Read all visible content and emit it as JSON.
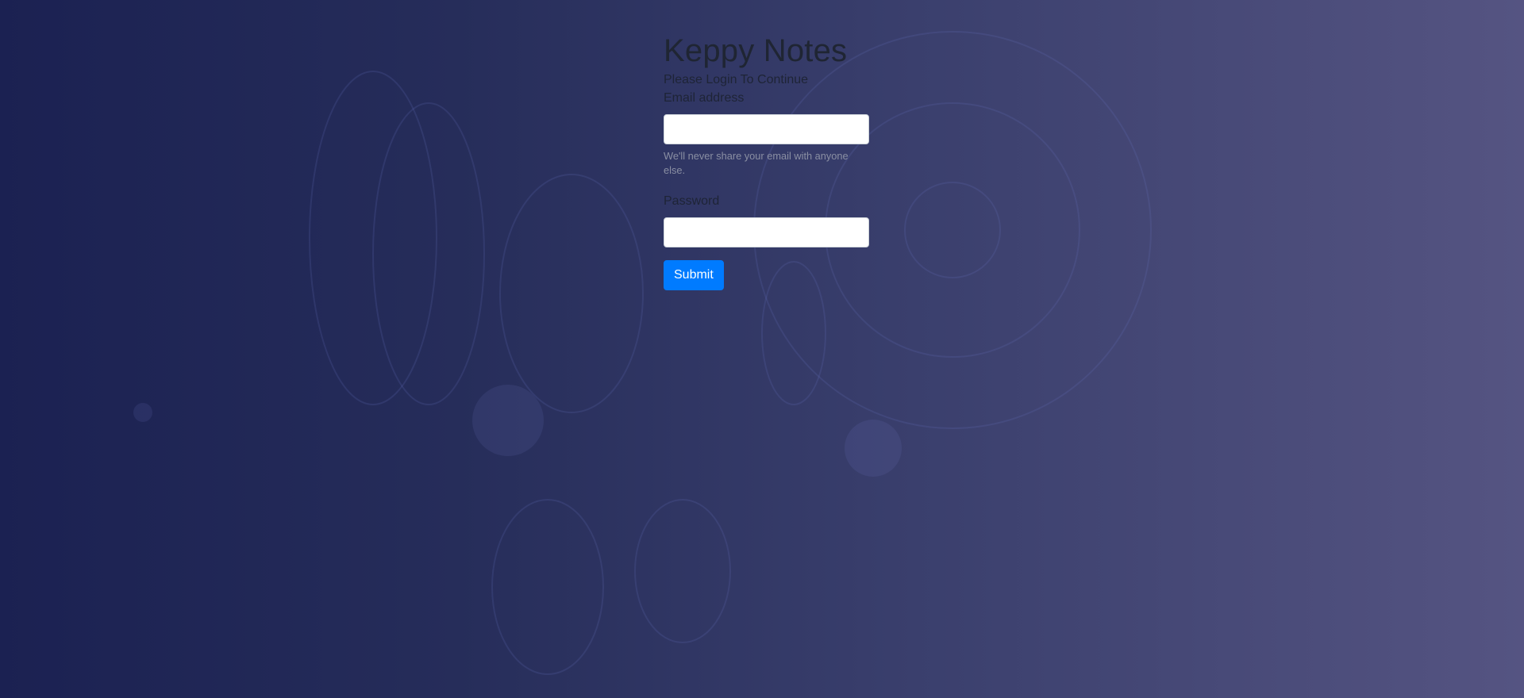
{
  "page": {
    "title": "Keppy Notes",
    "subtitle": "Please Login To Continue"
  },
  "form": {
    "email_label": "Email address",
    "email_value": "",
    "email_help": "We'll never share your email with anyone else.",
    "password_label": "Password",
    "password_value": "",
    "submit_label": "Submit"
  },
  "colors": {
    "primary_button": "#007bff",
    "background_start": "#1b2152",
    "background_end": "#555482"
  }
}
